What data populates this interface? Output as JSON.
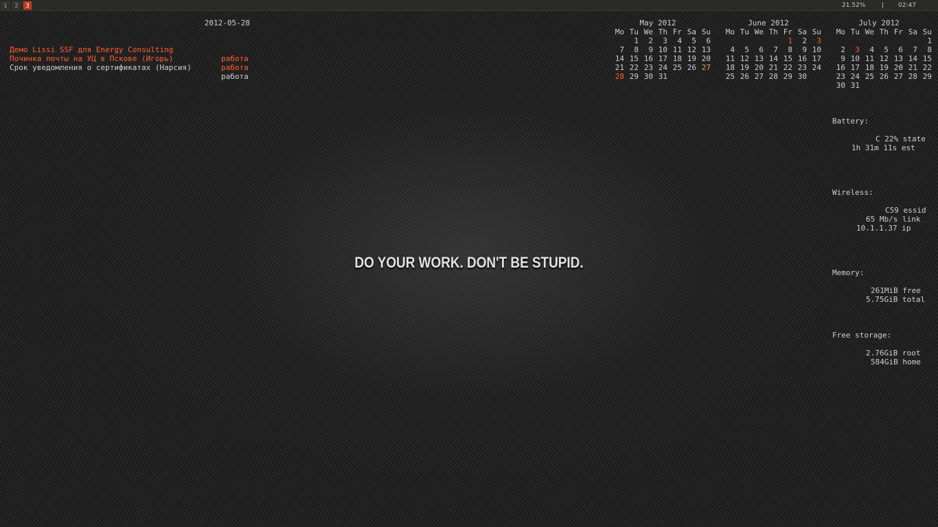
{
  "topbar": {
    "workspaces": [
      "1",
      "2",
      "3"
    ],
    "active_workspace": "3",
    "accent_color": "#b83a1c",
    "battery_percent": "21.52%",
    "separator": "|",
    "clock": "02:47"
  },
  "tasks": {
    "date": "2012-05-28",
    "items": [
      {
        "name": "Демо Lissi SSF для Energy Consulting",
        "tag": "работа",
        "status": "urgent"
      },
      {
        "name": "Починка почты на УЦ в Пскове (Игорь)",
        "tag": "работа",
        "status": "urgent"
      },
      {
        "name": "Срок уведомления о сертификатах (Нарсия)",
        "tag": "работа",
        "status": "normal"
      }
    ]
  },
  "calendars": [
    {
      "title": "May 2012",
      "weekdays": [
        "Mo",
        "Tu",
        "We",
        "Th",
        "Fr",
        "Sa",
        "Su"
      ],
      "weeks": [
        [
          "",
          "1",
          "2",
          "3",
          "4",
          "5",
          "6"
        ],
        [
          "7",
          "8",
          "9",
          "10",
          "11",
          "12",
          "13"
        ],
        [
          "14",
          "15",
          "16",
          "17",
          "18",
          "19",
          "20"
        ],
        [
          "21",
          "22",
          "23",
          "24",
          "25",
          "26",
          "27"
        ],
        [
          "28",
          "29",
          "30",
          "31",
          "",
          "",
          ""
        ]
      ],
      "highlight_today": [
        "28"
      ],
      "highlight_other": [
        "27"
      ]
    },
    {
      "title": "June 2012",
      "weekdays": [
        "Mo",
        "Tu",
        "We",
        "Th",
        "Fr",
        "Sa",
        "Su"
      ],
      "weeks": [
        [
          "",
          "",
          "",
          "",
          "1",
          "2",
          "3"
        ],
        [
          "4",
          "5",
          "6",
          "7",
          "8",
          "9",
          "10"
        ],
        [
          "11",
          "12",
          "13",
          "14",
          "15",
          "16",
          "17"
        ],
        [
          "18",
          "19",
          "20",
          "21",
          "22",
          "23",
          "24"
        ],
        [
          "25",
          "26",
          "27",
          "28",
          "29",
          "30",
          ""
        ]
      ],
      "highlight_today": [
        "1",
        "3"
      ],
      "highlight_other": []
    },
    {
      "title": "July 2012",
      "weekdays": [
        "Mo",
        "Tu",
        "We",
        "Th",
        "Fr",
        "Sa",
        "Su"
      ],
      "weeks": [
        [
          "",
          "",
          "",
          "",
          "",
          "",
          "1"
        ],
        [
          "2",
          "3",
          "4",
          "5",
          "6",
          "7",
          "8"
        ],
        [
          "9",
          "10",
          "11",
          "12",
          "13",
          "14",
          "15"
        ],
        [
          "16",
          "17",
          "18",
          "19",
          "20",
          "21",
          "22"
        ],
        [
          "23",
          "24",
          "25",
          "26",
          "27",
          "28",
          "29"
        ],
        [
          "30",
          "31",
          "",
          "",
          "",
          "",
          ""
        ]
      ],
      "highlight_today": [
        "3"
      ],
      "highlight_other": []
    }
  ],
  "status": {
    "battery": {
      "heading": "Battery:",
      "lines": [
        "C 22% state",
        "1h 31m 11s est"
      ]
    },
    "wireless": {
      "heading": "Wireless:",
      "lines": [
        "C59 essid",
        "65 Mb/s link",
        "10.1.1.37 ip"
      ]
    },
    "memory": {
      "heading": "Memory:",
      "lines": [
        "261MiB free",
        "5.75GiB total"
      ]
    },
    "storage": {
      "heading": "Free storage:",
      "lines": [
        "2.76GiB root",
        "584GiB home"
      ]
    }
  },
  "wallpaper": {
    "slogan": "DO YOUR WORK. DON'T BE STUPID."
  },
  "colors": {
    "urgent": "#ff5f2e",
    "weekend_highlight": "#ff9a3c",
    "text": "#cfcfcf",
    "bar_bg": "#2a2a26"
  }
}
